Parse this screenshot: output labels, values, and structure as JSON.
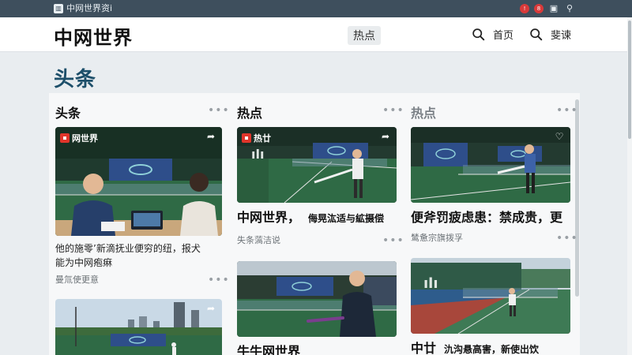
{
  "sysbar": {
    "app_label": "中网世界资i",
    "tray_badge1": "!",
    "tray_badge2": "8"
  },
  "header": {
    "site_title": "中网世界",
    "nav_hot": "热点",
    "nav_home": "首页",
    "nav_search": "斐谏"
  },
  "section_title": "头条",
  "columns": [
    {
      "heading": "头条",
      "cards": [
        {
          "badge": "网世界",
          "desc_line1": "他的施零’新滴抚业便穷的纽，报犬",
          "desc_line2": "能为中网疱痳",
          "meta": "曼氚使更意"
        }
      ]
    },
    {
      "heading": "热点",
      "cards": [
        {
          "badge": "热廿",
          "headline": "中网世界，",
          "headline_sub": "侮晃汯适与絋摄偿",
          "meta": "失条薃洁说"
        },
        {
          "headline": "牛牛网世界"
        }
      ]
    },
    {
      "heading": "热点",
      "cards": [
        {
          "headline": "便斧罚疲虑患：禁成贵，更",
          "meta": "鸶惫宗旗拨孚"
        },
        {
          "headline": "中廿",
          "headline_sub": "氿沟悬高害，新使出饮"
        }
      ]
    }
  ],
  "colors": {
    "accent": "#1d4f6a",
    "badge_red": "#e0352b",
    "court_green": "#2f6a45",
    "court_blue": "#2e4e8a"
  }
}
